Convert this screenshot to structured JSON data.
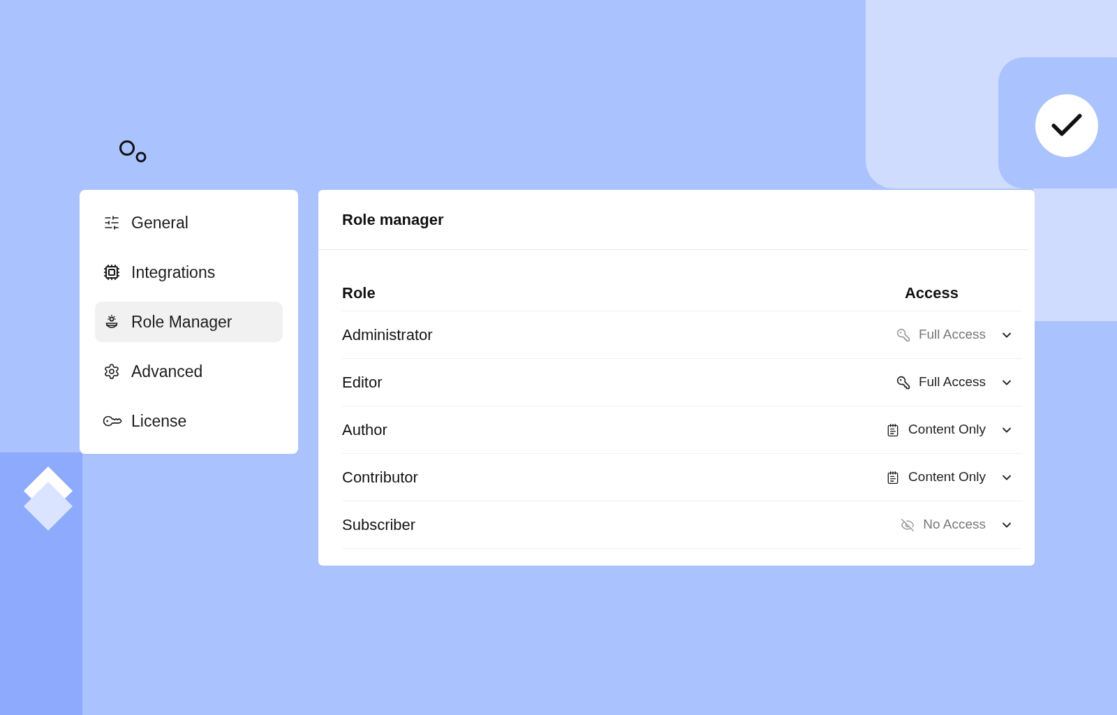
{
  "sidebar": {
    "items": [
      {
        "label": "General",
        "selected": false
      },
      {
        "label": "Integrations",
        "selected": false
      },
      {
        "label": "Role Manager",
        "selected": true
      },
      {
        "label": "Advanced",
        "selected": false
      },
      {
        "label": "License",
        "selected": false
      }
    ]
  },
  "panel": {
    "title": "Role manager",
    "table": {
      "columns": [
        "Role",
        "Access"
      ],
      "rows": [
        {
          "role": "Administrator",
          "access": "Full Access",
          "kind": "full",
          "muted": true
        },
        {
          "role": "Editor",
          "access": "Full Access",
          "kind": "full",
          "muted": false
        },
        {
          "role": "Author",
          "access": "Content Only",
          "kind": "content",
          "muted": false
        },
        {
          "role": "Contributor",
          "access": "Content Only",
          "kind": "content",
          "muted": false
        },
        {
          "role": "Subscriber",
          "access": "No Access",
          "kind": "none",
          "muted": true
        }
      ]
    }
  }
}
